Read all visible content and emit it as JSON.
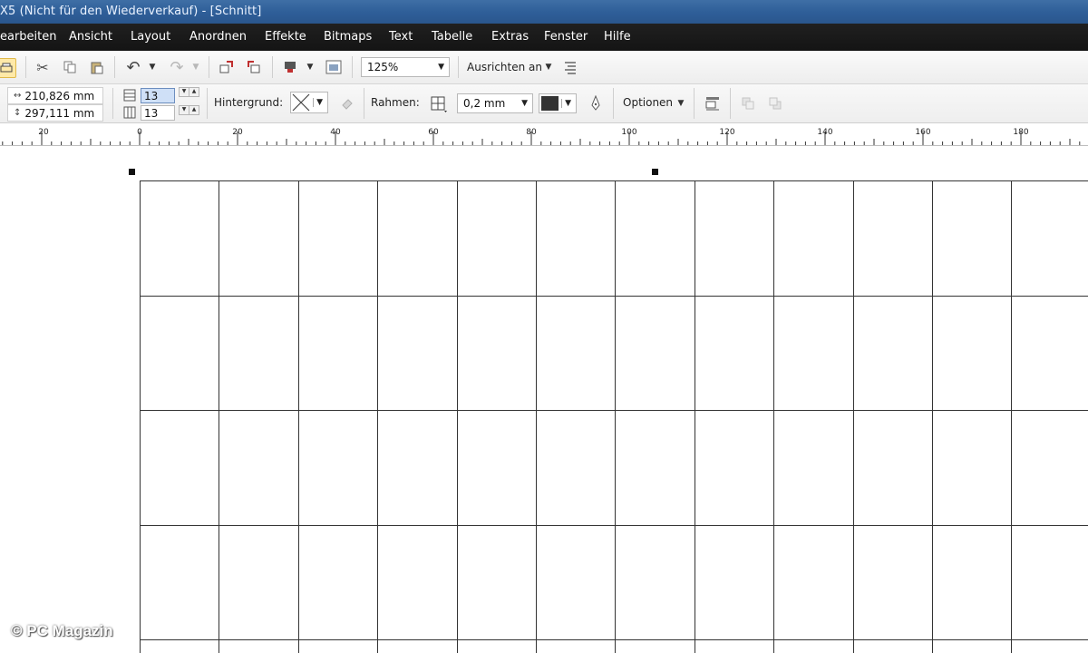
{
  "window": {
    "title": "X5 (Nicht für den Wiederverkauf) - [Schnitt]"
  },
  "menubar": {
    "items": [
      "earbeiten",
      "Ansicht",
      "Layout",
      "Anordnen",
      "Effekte",
      "Bitmaps",
      "Text",
      "Tabelle",
      "Extras",
      "Fenster",
      "Hilfe"
    ]
  },
  "toolbar": {
    "zoom": "125%",
    "align_label": "Ausrichten an"
  },
  "propertybar": {
    "width": "210,826 mm",
    "height": "297,111 mm",
    "rows": "13",
    "columns": "13",
    "background_label": "Hintergrund:",
    "border_label": "Rahmen:",
    "border_width": "0,2 mm",
    "options_label": "Optionen"
  },
  "ruler": {
    "labels": [
      "20",
      "0",
      "20",
      "40",
      "60",
      "80",
      "100",
      "120",
      "140",
      "160",
      "180"
    ]
  },
  "watermark": "© PC Magazin",
  "colors": {
    "titlebar": "#2f5f99",
    "menubar": "#1a1a1a",
    "border_color_swatch": "#333333"
  }
}
